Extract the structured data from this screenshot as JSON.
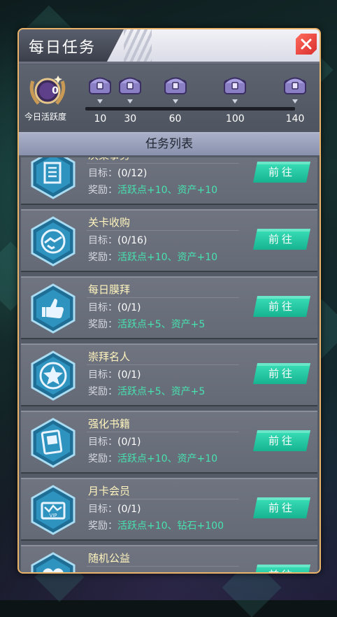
{
  "window": {
    "title": "每日任务"
  },
  "activity": {
    "current_value": "0",
    "label": "今日活跃度",
    "progress": 0,
    "max": 140,
    "milestones": [
      {
        "value": "10"
      },
      {
        "value": "30"
      },
      {
        "value": "60"
      },
      {
        "value": "100"
      },
      {
        "value": "140"
      }
    ]
  },
  "list": {
    "header": "任务列表",
    "goal_label": "目标：",
    "reward_label": "奖励：",
    "button_label": "前往",
    "tasks": [
      {
        "name": "决策事务",
        "goal": "(0/12)",
        "reward": "活跃点+10、资产+10",
        "icon": "document-icon"
      },
      {
        "name": "关卡收购",
        "goal": "(0/16)",
        "reward": "活跃点+10、资产+10",
        "icon": "handshake-icon"
      },
      {
        "name": "每日膜拜",
        "goal": "(0/1)",
        "reward": "活跃点+5、资产+5",
        "icon": "thumbs-up-icon"
      },
      {
        "name": "崇拜名人",
        "goal": "(0/1)",
        "reward": "活跃点+5、资产+5",
        "icon": "star-icon"
      },
      {
        "name": "强化书籍",
        "goal": "(0/1)",
        "reward": "活跃点+10、资产+10",
        "icon": "book-icon"
      },
      {
        "name": "月卡会员",
        "goal": "(0/1)",
        "reward": "活跃点+10、钻石+100",
        "icon": "vip-card-icon"
      },
      {
        "name": "随机公益",
        "goal": "",
        "reward": "",
        "icon": "heart-icon"
      }
    ]
  },
  "colors": {
    "frame": "#e9b36a",
    "task_name": "#fff4bd",
    "reward_value": "#46e3b0",
    "go_button": "#1fc9a2",
    "close_button": "#e23b36"
  }
}
